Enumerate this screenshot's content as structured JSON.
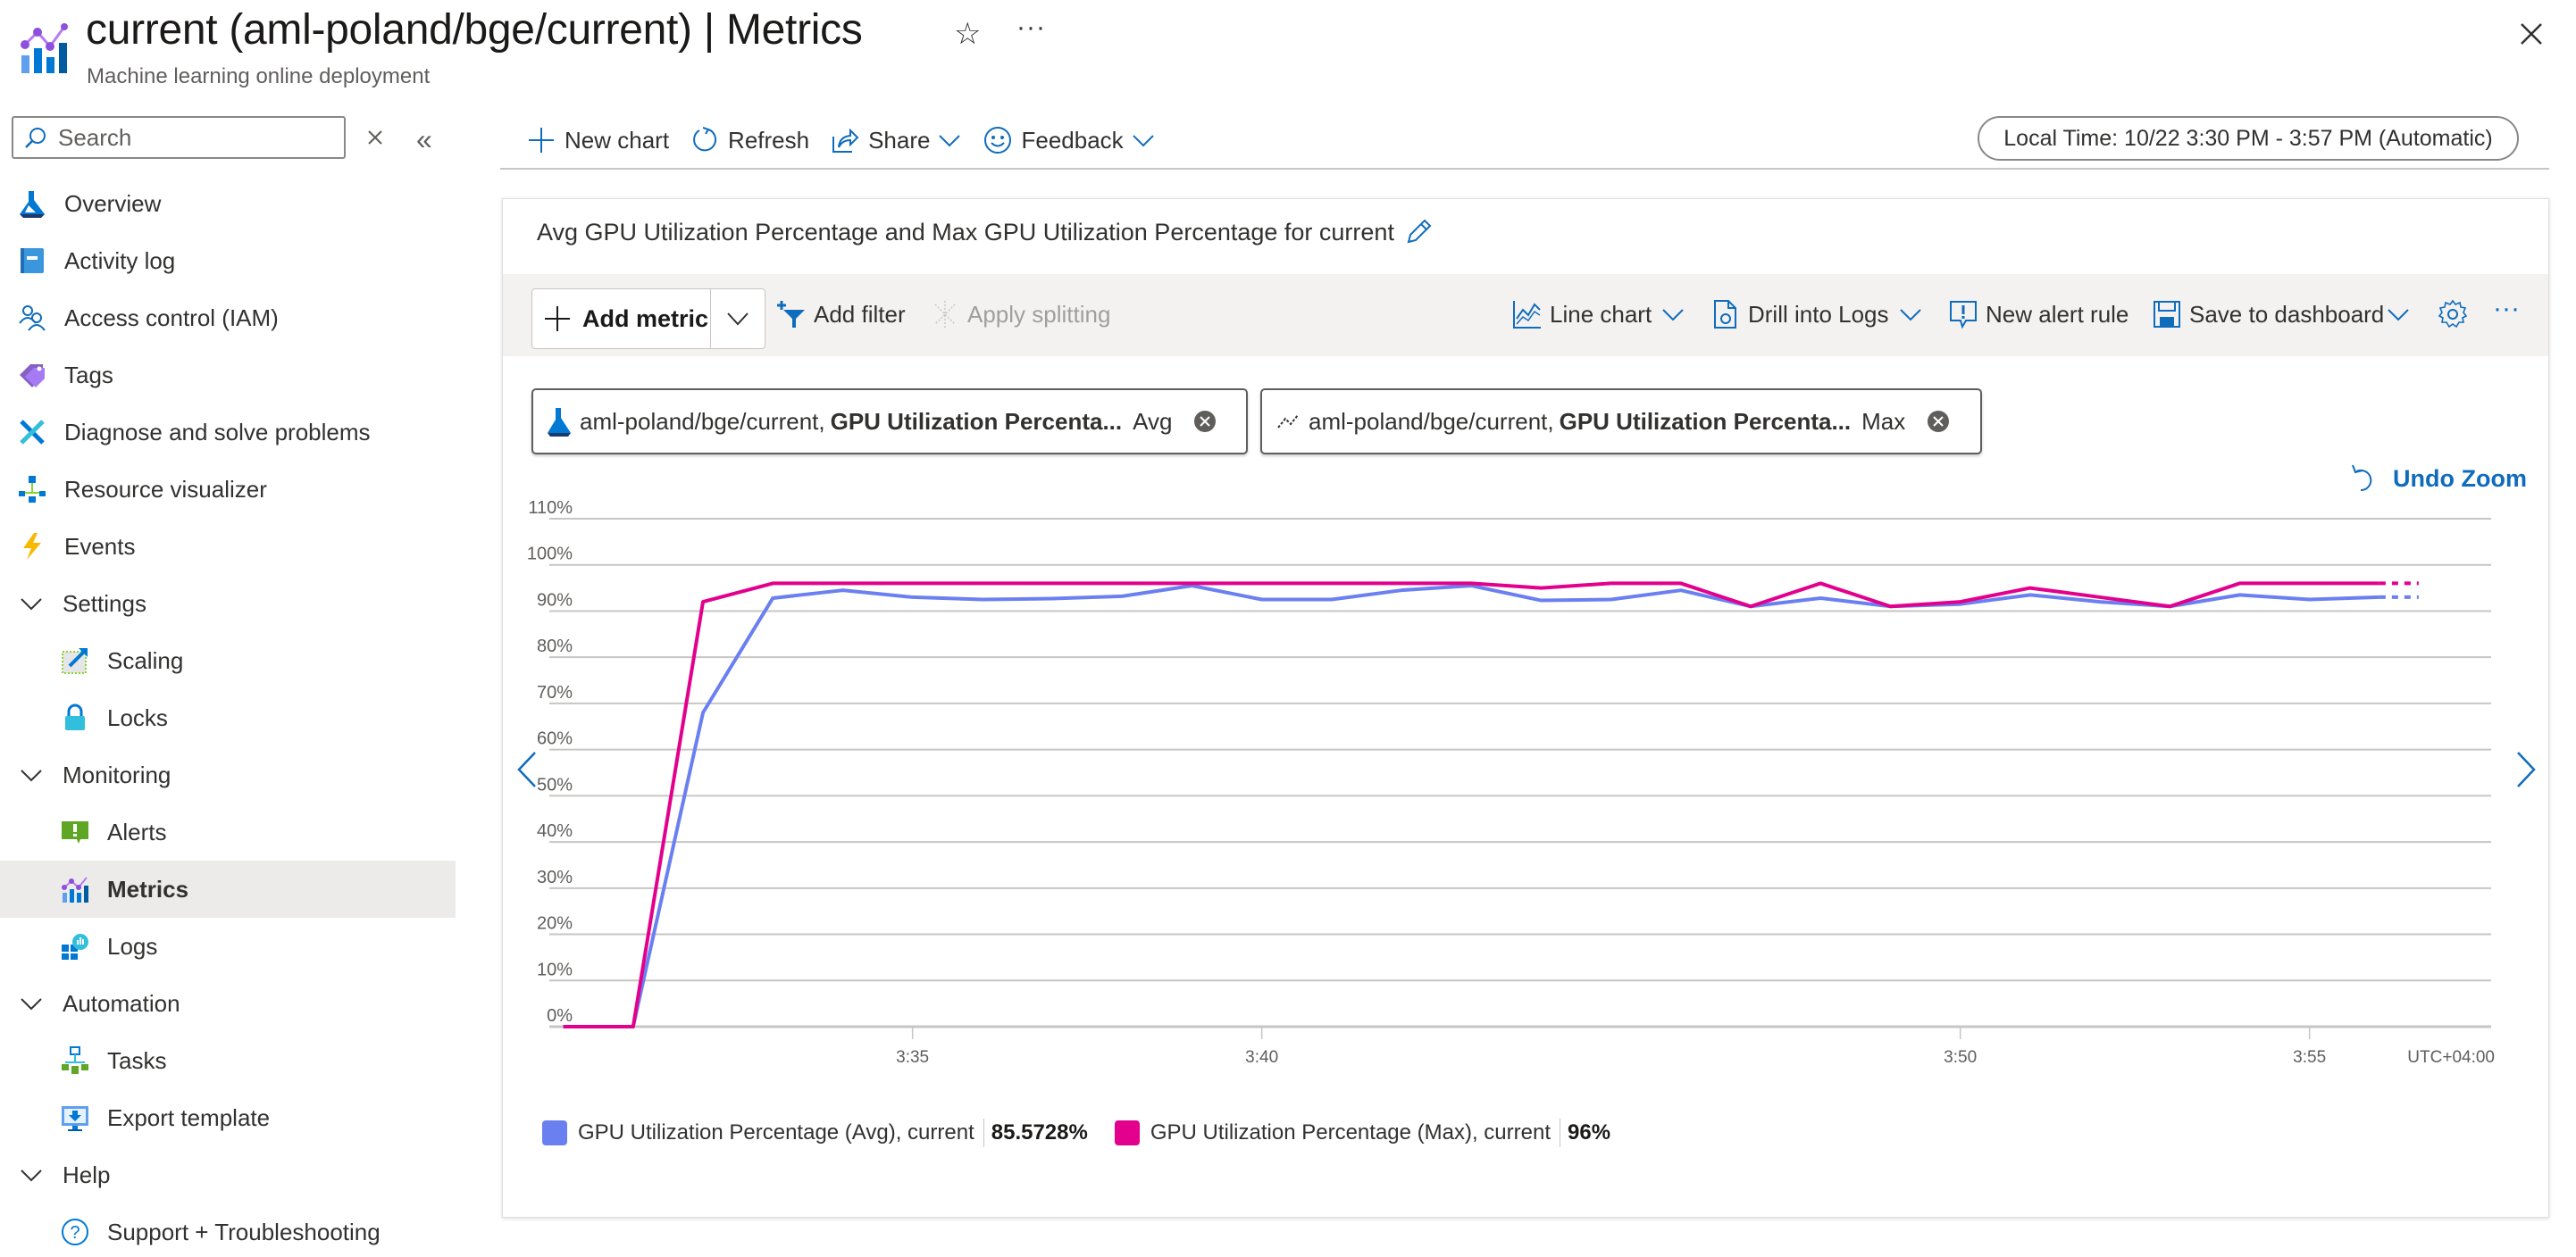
{
  "header": {
    "title": "current (aml-poland/bge/current) | Metrics",
    "subtitle": "Machine learning online deployment",
    "favorite_icon": "star-icon",
    "more_icon": "ellipsis-icon",
    "close_icon": "close-icon"
  },
  "sidebar": {
    "search_placeholder": "Search",
    "items": [
      {
        "label": "Overview",
        "icon": "azure-ml-icon",
        "level": 0
      },
      {
        "label": "Activity log",
        "icon": "activity-log-icon",
        "level": 0
      },
      {
        "label": "Access control (IAM)",
        "icon": "people-icon",
        "level": 0
      },
      {
        "label": "Tags",
        "icon": "tag-icon",
        "level": 0
      },
      {
        "label": "Diagnose and solve problems",
        "icon": "wrench-icon",
        "level": 0
      },
      {
        "label": "Resource visualizer",
        "icon": "hierarchy-icon",
        "level": 0
      },
      {
        "label": "Events",
        "icon": "lightning-icon",
        "level": 0
      },
      {
        "label": "Settings",
        "icon": "chevron-down-icon",
        "level": 0,
        "group": true
      },
      {
        "label": "Scaling",
        "icon": "scaling-icon",
        "level": 1
      },
      {
        "label": "Locks",
        "icon": "lock-icon",
        "level": 1
      },
      {
        "label": "Monitoring",
        "icon": "chevron-down-icon",
        "level": 0,
        "group": true
      },
      {
        "label": "Alerts",
        "icon": "alert-icon",
        "level": 1
      },
      {
        "label": "Metrics",
        "icon": "metrics-icon",
        "level": 1,
        "selected": true
      },
      {
        "label": "Logs",
        "icon": "logs-icon",
        "level": 1
      },
      {
        "label": "Automation",
        "icon": "chevron-down-icon",
        "level": 0,
        "group": true
      },
      {
        "label": "Tasks",
        "icon": "tasks-icon",
        "level": 1
      },
      {
        "label": "Export template",
        "icon": "export-template-icon",
        "level": 1
      },
      {
        "label": "Help",
        "icon": "chevron-down-icon",
        "level": 0,
        "group": true
      },
      {
        "label": "Support + Troubleshooting",
        "icon": "help-icon",
        "level": 1
      }
    ]
  },
  "commandbar": {
    "new_chart": "New chart",
    "refresh": "Refresh",
    "share": "Share",
    "feedback": "Feedback",
    "time_range": "Local Time: 10/22 3:30 PM - 3:57 PM (Automatic)"
  },
  "chart_card": {
    "title": "Avg GPU Utilization Percentage and Max GPU Utilization Percentage for current",
    "toolbar": {
      "add_metric": "Add metric",
      "add_filter": "Add filter",
      "apply_splitting": "Apply splitting",
      "line_chart": "Line chart",
      "drill_into_logs": "Drill into Logs",
      "new_alert_rule": "New alert rule",
      "save_to_dashboard": "Save to dashboard"
    },
    "metric_pills": [
      {
        "resource": "aml-poland/bge/current,",
        "metric": "GPU Utilization Percenta...",
        "aggregation": "Avg"
      },
      {
        "resource": "aml-poland/bge/current,",
        "metric": "GPU Utilization Percenta...",
        "aggregation": "Max"
      }
    ],
    "undo_zoom": "Undo Zoom"
  },
  "chart_data": {
    "type": "line",
    "title": "Avg GPU Utilization Percentage and Max GPU Utilization Percentage for current",
    "xlabel": "",
    "ylabel": "",
    "timezone_label": "UTC+04:00",
    "x": [
      "3:30",
      "3:31",
      "3:32",
      "3:33",
      "3:34",
      "3:35",
      "3:36",
      "3:37",
      "3:38",
      "3:39",
      "3:40",
      "3:41",
      "3:42",
      "3:43",
      "3:44",
      "3:45",
      "3:46",
      "3:47",
      "3:48",
      "3:49",
      "3:50",
      "3:51",
      "3:52",
      "3:53",
      "3:54",
      "3:55",
      "3:56"
    ],
    "x_minutes": [
      30,
      31,
      32,
      33,
      34,
      35,
      36,
      37,
      38,
      39,
      40,
      41,
      42,
      43,
      44,
      45,
      46,
      47,
      48,
      49,
      50,
      51,
      52,
      53,
      54,
      55,
      56
    ],
    "xlim_minutes": [
      29.8,
      57.6
    ],
    "x_ticks": [
      {
        "label": "3:35",
        "minute": 35
      },
      {
        "label": "3:40",
        "minute": 40
      },
      {
        "label": "3:50",
        "minute": 50
      },
      {
        "label": "3:55",
        "minute": 55
      }
    ],
    "y_ticks": [
      "0%",
      "10%",
      "20%",
      "30%",
      "40%",
      "50%",
      "60%",
      "70%",
      "80%",
      "90%",
      "100%",
      "110%"
    ],
    "ylim": [
      0,
      110
    ],
    "grid": true,
    "legend_position": "bottom-left",
    "series": [
      {
        "name": "GPU Utilization Percentage (Avg), current",
        "summary": "85.5728%",
        "color": "#6b80f0",
        "values": [
          0,
          0,
          68,
          92.8,
          94.5,
          93,
          92.5,
          92.7,
          93.2,
          95.5,
          92.5,
          92.5,
          94.5,
          95.5,
          92.3,
          92.5,
          94.5,
          91,
          92.8,
          91,
          91.5,
          93.5,
          92,
          91,
          93.5,
          92.5,
          93
        ]
      },
      {
        "name": "GPU Utilization Percentage (Max), current",
        "summary": "96%",
        "color": "#e3008c",
        "values": [
          0,
          0,
          92,
          96,
          96,
          96,
          96,
          96,
          96,
          96,
          96,
          96,
          96,
          96,
          95,
          96,
          96,
          91,
          96,
          91,
          92,
          95,
          93,
          91,
          96,
          96,
          96
        ]
      }
    ]
  }
}
